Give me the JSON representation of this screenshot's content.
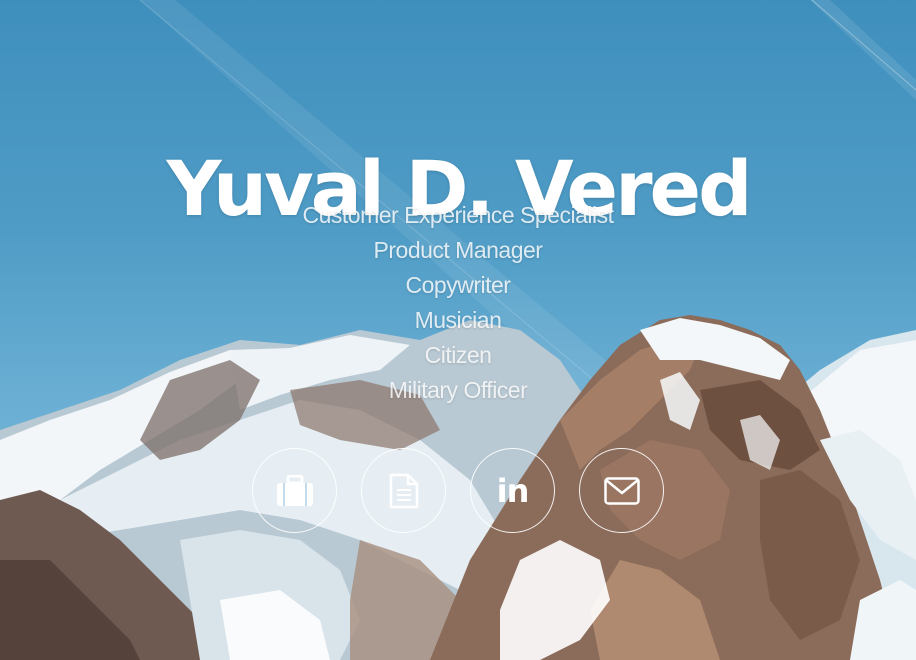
{
  "header": {
    "name": "Yuval D. Vered"
  },
  "roles": [
    "Customer Experience Specialist",
    "Product Manager",
    "Copywriter",
    "Musician",
    "Citizen",
    "Military Officer"
  ],
  "socials": [
    {
      "icon": "briefcase-icon"
    },
    {
      "icon": "document-icon"
    },
    {
      "icon": "linkedin-icon",
      "text": "in"
    },
    {
      "icon": "envelope-icon"
    }
  ],
  "colors": {
    "sky_top": "#3f8fbd",
    "sky_bottom": "#7fbcdc",
    "text": "#ffffff"
  }
}
